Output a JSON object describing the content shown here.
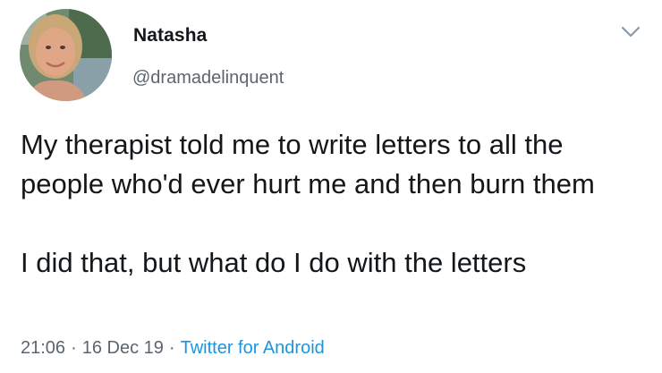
{
  "user": {
    "display_name": "Natasha",
    "handle": "@dramadelinquent",
    "avatar_icon": "profile-photo"
  },
  "menu": {
    "icon": "chevron-down-icon"
  },
  "tweet": {
    "paragraph_1": "My therapist told me to write letters to all the people who'd ever hurt me and then burn them",
    "paragraph_2": "I did that, but what do I do with the letters"
  },
  "meta": {
    "time": "21:06",
    "separator": "·",
    "date": "16 Dec 19",
    "source": "Twitter for Android"
  },
  "colors": {
    "text": "#14171a",
    "secondary": "#5b6570",
    "link": "#1b95e0"
  }
}
